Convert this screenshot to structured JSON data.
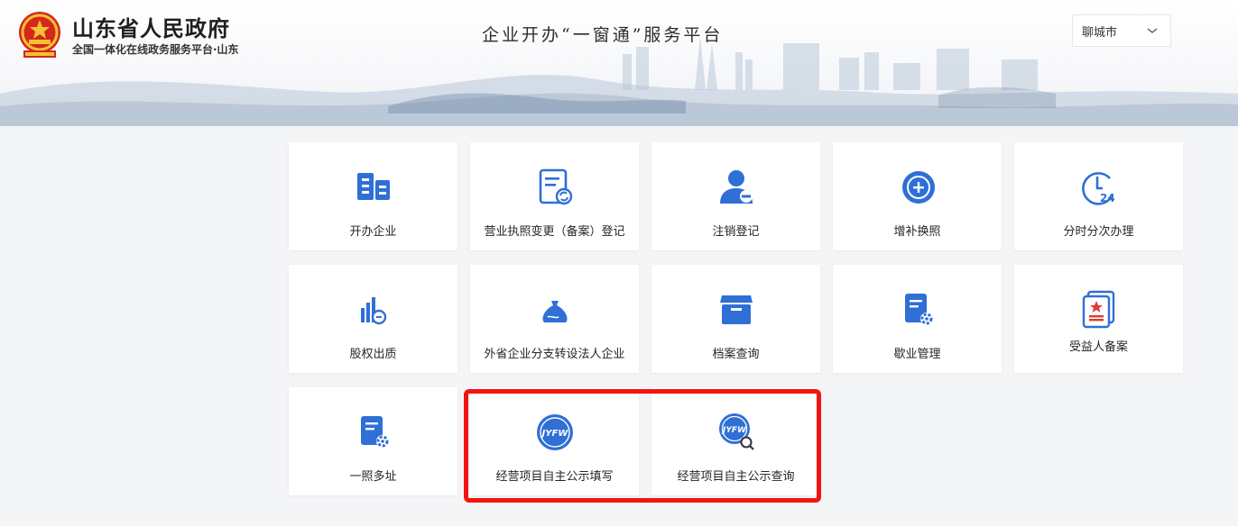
{
  "header": {
    "site_title": "山东省人民政府",
    "site_subtitle": "全国一体化在线政务服务平台·山东",
    "platform_title": "企业开办“一窗通”服务平台",
    "city_select": {
      "value": "聊城市"
    }
  },
  "colors": {
    "icon_primary": "#2f6fd6",
    "highlight": "#f2150f",
    "accent_red": "#e0392f"
  },
  "tiles": [
    {
      "label": "开办企业",
      "icon": "building-icon"
    },
    {
      "label": "营业执照变更（备案）登记",
      "icon": "document-refresh-icon"
    },
    {
      "label": "注销登记",
      "icon": "user-remove-icon"
    },
    {
      "label": "增补换照",
      "icon": "plus-circle-icon"
    },
    {
      "label": "分时分次办理",
      "icon": "clock-24-icon"
    },
    {
      "label": "股权出质",
      "icon": "equity-chart-icon"
    },
    {
      "label": "外省企业分支转设法人企业",
      "icon": "money-bag-icon"
    },
    {
      "label": "档案查询",
      "icon": "archive-box-icon"
    },
    {
      "label": "歇业管理",
      "icon": "document-gear-icon"
    },
    {
      "label": "受益人备案",
      "icon": "star-document-icon"
    },
    {
      "label": "一照多址",
      "icon": "document-gear-icon"
    },
    {
      "label": "经营项目自主公示填写",
      "icon": "jyfw-badge-icon"
    },
    {
      "label": "经营项目自主公示查询",
      "icon": "jyfw-search-icon"
    }
  ]
}
